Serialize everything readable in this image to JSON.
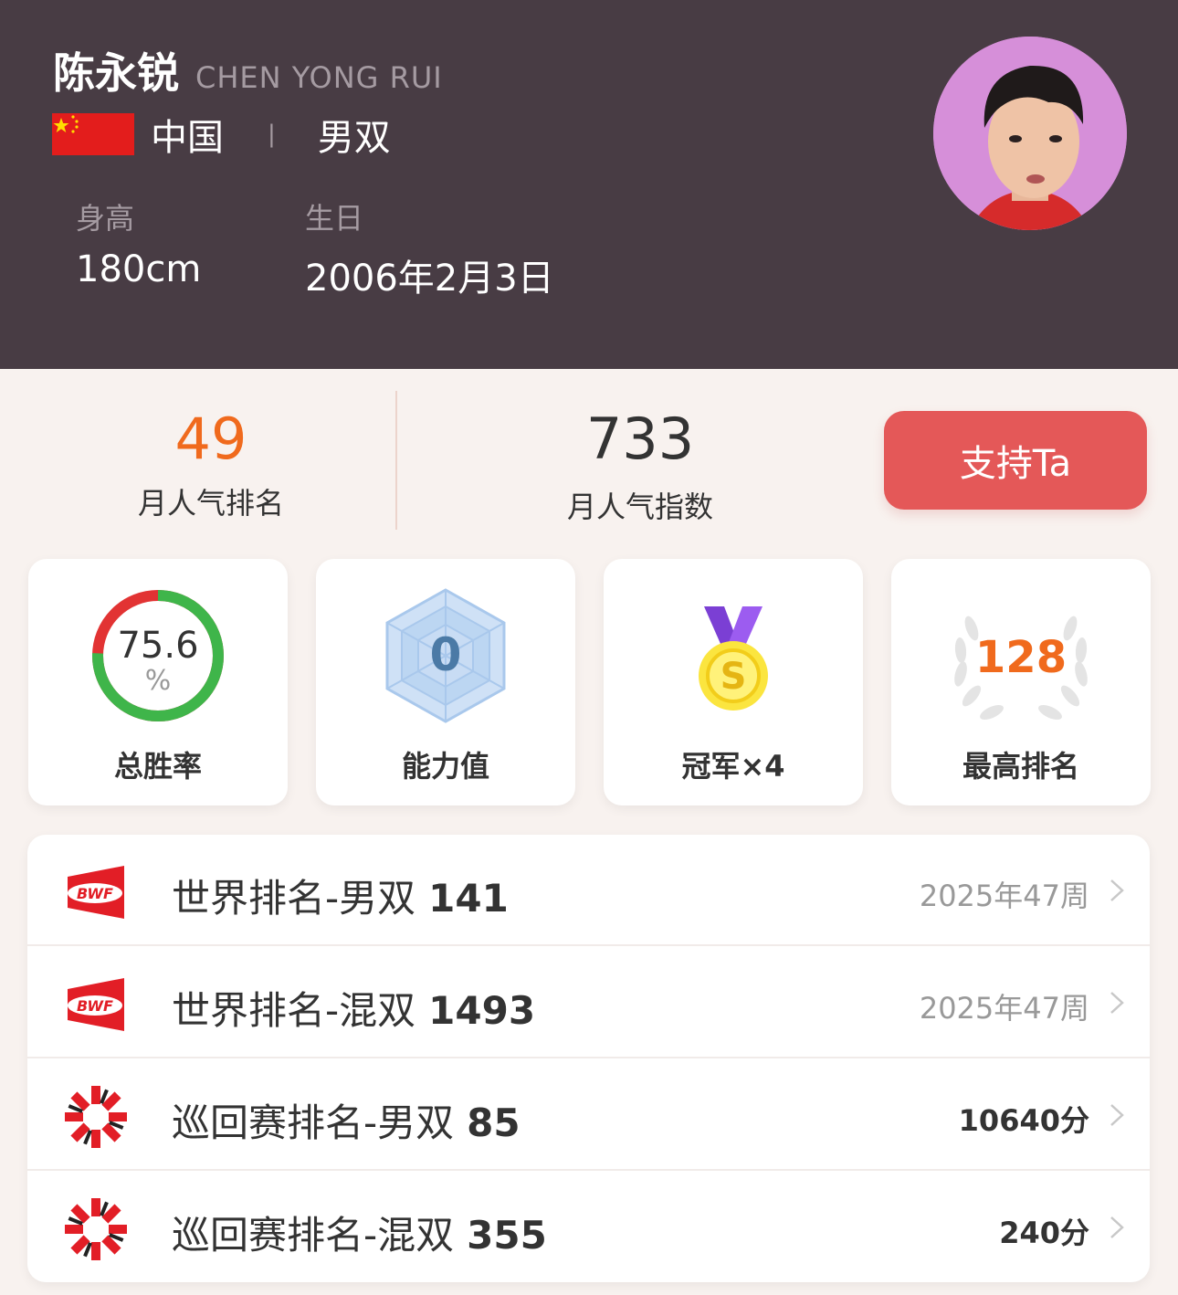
{
  "player": {
    "name_cn": "陈永锐",
    "name_en": "CHEN YONG RUI",
    "country": "中国",
    "separator": "|",
    "event": "男双",
    "height_label": "身高",
    "height_value": "180cm",
    "birthday_label": "生日",
    "birthday_value": "2006年2月3日"
  },
  "popularity": {
    "rank_value": "49",
    "rank_label": "月人气排名",
    "index_value": "733",
    "index_label": "月人气指数",
    "support_button": "支持Ta"
  },
  "stats": {
    "win_rate": {
      "value": "75.6",
      "unit": "%",
      "label": "总胜率",
      "fraction": 0.756
    },
    "ability": {
      "value": "0",
      "label": "能力值"
    },
    "champion": {
      "label": "冠军×4",
      "medal_letter": "S"
    },
    "best_rank": {
      "value": "128",
      "label": "最高排名"
    }
  },
  "rankings": [
    {
      "logo": "bwf-logo",
      "title": "世界排名-男双",
      "number": "141",
      "right": "2025年47周",
      "right_style": "gray"
    },
    {
      "logo": "bwf-logo",
      "title": "世界排名-混双",
      "number": "1493",
      "right": "2025年47周",
      "right_style": "gray"
    },
    {
      "logo": "tour-logo",
      "title": "巡回赛排名-男双",
      "number": "85",
      "right": "10640分",
      "right_style": "dark"
    },
    {
      "logo": "tour-logo",
      "title": "巡回赛排名-混双",
      "number": "355",
      "right": "240分",
      "right_style": "dark"
    }
  ],
  "colors": {
    "header_bg": "#483c44",
    "accent_orange": "#f06a1d",
    "support_red": "#e45858",
    "win_green": "#3fb54a",
    "loss_red": "#e23333"
  },
  "icons": [
    "china-flag-icon",
    "avatar-photo",
    "win-rate-ring",
    "ability-hexagon-icon",
    "medal-icon",
    "laurel-wreath-icon",
    "bwf-logo",
    "tour-logo",
    "chevron-right-icon"
  ]
}
